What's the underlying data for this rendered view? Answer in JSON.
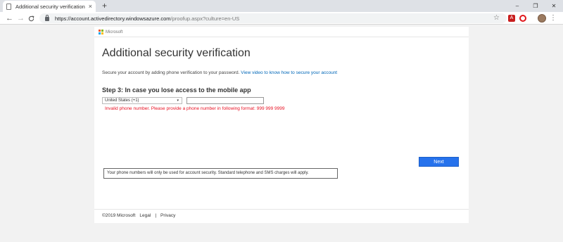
{
  "browser": {
    "tab_title": "Additional security verification",
    "tab_close": "×",
    "new_tab": "+",
    "window_controls": {
      "minimize": "–",
      "restore": "❐",
      "close": "✕"
    },
    "nav": {
      "back": "←",
      "forward": "→",
      "reload": "C"
    },
    "url_host": "https://account.activedirectory.windowsazure.com",
    "url_path": "/proofup.aspx?culture=en-US",
    "star": "☆",
    "pdf_ext": "A",
    "menu": "⋮"
  },
  "page": {
    "brand": "Microsoft",
    "title": "Additional security verification",
    "intro_text": "Secure your account by adding phone verification to your password.",
    "intro_link": "View video to know how to secure your account",
    "step_title": "Step 3: In case you lose access to the mobile app",
    "country_value": "United States (+1)",
    "country_caret": "▾",
    "phone_value": "",
    "error_text": "Invalid phone number. Please provide a phone number in following format: 999 999 9999",
    "next_label": "Next",
    "notice_text": "Your phone numbers will only be used for account security. Standard telephone and SMS charges will apply."
  },
  "footer": {
    "copyright": "©2019 Microsoft",
    "legal": "Legal",
    "separator": "|",
    "privacy": "Privacy"
  },
  "colors": {
    "accent": "#2672ec",
    "link": "#0067b8",
    "error": "#e81123"
  }
}
